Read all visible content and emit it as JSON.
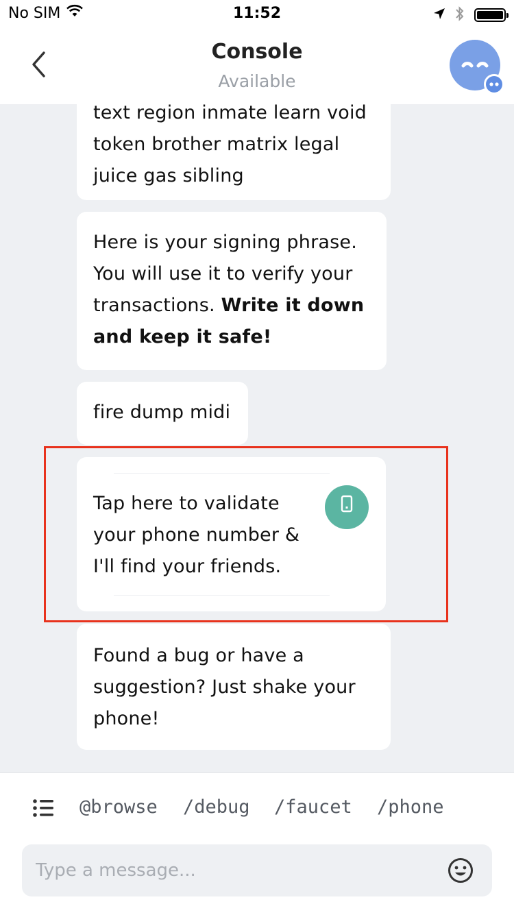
{
  "status_bar": {
    "carrier": "No SIM",
    "time": "11:52",
    "icons": [
      "wifi-icon",
      "location-arrow-icon",
      "bluetooth-icon",
      "battery-icon"
    ]
  },
  "header": {
    "title": "Console",
    "subtitle": "Available",
    "back_icon": "chevron-left-icon",
    "avatar_color": "#7aa0e6"
  },
  "messages": [
    {
      "text": "text region inmate learn void token brother matrix legal juice gas sibling"
    },
    {
      "text_plain": "Here is your signing phrase. You will use it to verify your transactions. ",
      "text_bold": "Write it down and keep it safe!"
    },
    {
      "text": "fire dump midi"
    },
    {
      "text": "Tap here to validate your phone number & I'll find your friends.",
      "action_icon": "phone-icon",
      "action_color": "#5bb5a2"
    },
    {
      "text": "Found a bug or have a suggestion? Just shake your phone!"
    }
  ],
  "commands": [
    "@browse",
    "/debug",
    "/faucet",
    "/phone"
  ],
  "composer": {
    "placeholder": "Type a message...",
    "menu_icon": "list-icon",
    "emoji_icon": "smiley-icon"
  },
  "colors": {
    "highlight": "#e8321c",
    "chat_background": "#eef0f3"
  }
}
